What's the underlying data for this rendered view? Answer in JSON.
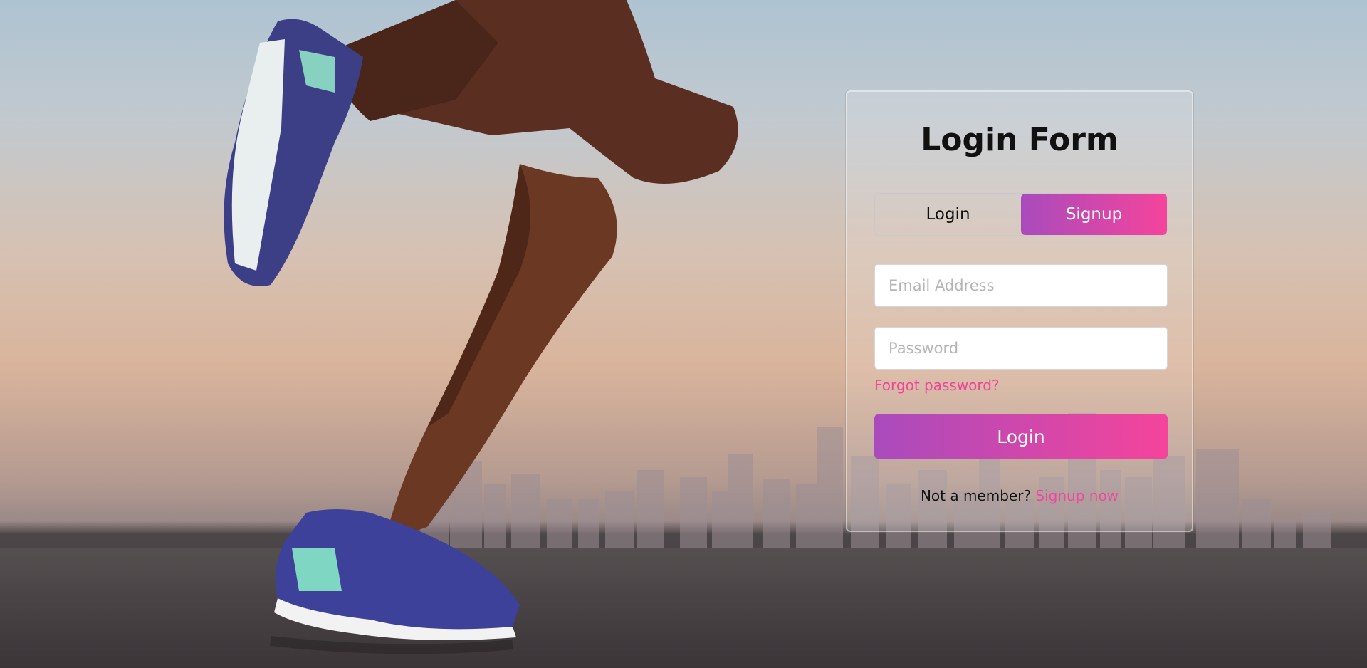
{
  "form": {
    "title": "Login Form",
    "tabs": [
      {
        "label": "Login",
        "active": false
      },
      {
        "label": "Signup",
        "active": true
      }
    ],
    "email": {
      "value": "",
      "placeholder": "Email Address"
    },
    "password": {
      "value": "",
      "placeholder": "Password"
    },
    "forgot_label": "Forgot password?",
    "submit_label": "Login",
    "member_prompt": "Not a member?",
    "member_link": "Signup now"
  },
  "colors": {
    "accent_start": "#a94bbd",
    "accent_end": "#f5449b",
    "link": "#f0449a"
  },
  "background": {
    "image": "runner-legs-on-rooftop-city-skyline"
  }
}
